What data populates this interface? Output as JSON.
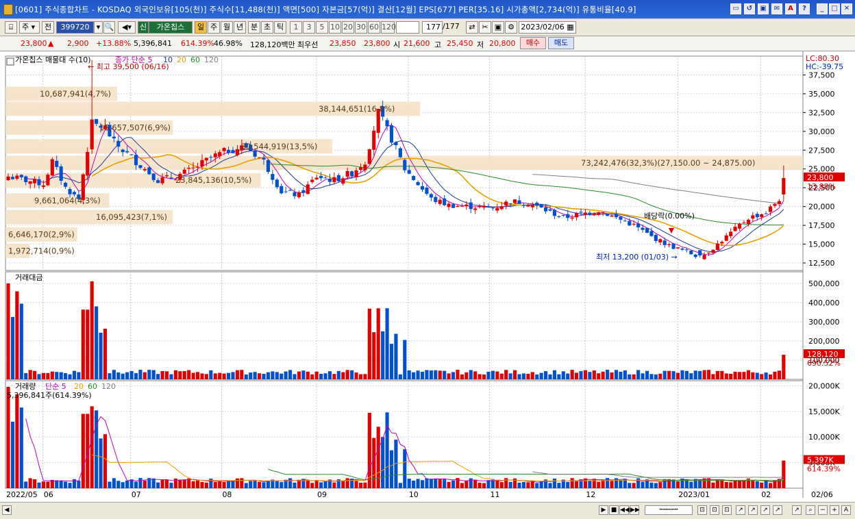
{
  "window": {
    "title": "[0601] 주식종합차트 - KOSDAQ 외국인보유[105(천)] 주식수[11,488(천)] 액면[500] 자본금[57(억)] 결산[12월] EPS[677] PER[35.16] 시가총액[2,734(억)] 유통비율[40.9]",
    "buttons": [
      "▭",
      "↺",
      "▣",
      "✉",
      "A",
      "?",
      "_",
      "□",
      "✕"
    ]
  },
  "toolbar": {
    "market": "주",
    "all": "전",
    "code": "399720",
    "stock_tag": "신",
    "stock_name": "가온칩스",
    "periods": [
      "일",
      "주",
      "월",
      "년",
      "분",
      "초",
      "틱"
    ],
    "ticks": [
      "1",
      "3",
      "5",
      "10",
      "20",
      "30",
      "60",
      "120"
    ],
    "count": "177",
    "count_total": "/177",
    "date": "2023/02/06"
  },
  "quote": {
    "price": "23,800",
    "arrow": "▲",
    "change": "2,900",
    "change_pct": "+13.88%",
    "volume": "5,396,841",
    "volume_ratio": "614.39%",
    "turnover": "46.98%",
    "amount": "128,120백만",
    "best_label": "최우선",
    "best_ask": "23,850",
    "best_bid": "23,800",
    "open_label": "시",
    "open": "21,600",
    "high_label": "고",
    "high": "25,450",
    "low_label": "저",
    "low": "20,800",
    "buy": "매수",
    "sell": "매도"
  },
  "price_panel": {
    "legend_name": "가온칩스 매물대 수(10)",
    "legend_ma": "종가 단순 5",
    "legend_ma_periods": [
      "10",
      "20",
      "60",
      "120"
    ],
    "lc": "LC:80.30",
    "hc": "HC:-39.75",
    "high_annot": "최고 39,500 (06/16)",
    "low_annot": "최저 13,200 (01/03)",
    "dividend": "배당락(0.00%)",
    "y_ticks": [
      "37,500",
      "35,000",
      "32,500",
      "30,000",
      "27,500",
      "25,000",
      "22,500",
      "20,000",
      "17,500",
      "15,000",
      "12,500"
    ],
    "last_price": "23,800",
    "last_pct": "13.88%",
    "volume_profile": [
      {
        "label": "10,687,941(4,7%)",
        "price": 35000
      },
      {
        "label": "15,657,507(6,9%)",
        "price": 30500
      },
      {
        "label": "38,144,651(16,8%)",
        "price": 33000
      },
      {
        "label": "30,544,919(13,5%)",
        "price": 28000
      },
      {
        "label": "73,242,476(32,3%)(27,150.00 ~ 24,875.00)",
        "price": 25800
      },
      {
        "label": "23,845,136(10,5%)",
        "price": 23500
      },
      {
        "label": "9,661,064(4,3%)",
        "price": 20800
      },
      {
        "label": "16,095,423(7,1%)",
        "price": 18600
      },
      {
        "label": "6,646,170(2,9%)",
        "price": 16300
      },
      {
        "label": "1,972,714(0,9%)",
        "price": 14100
      }
    ]
  },
  "amount_panel": {
    "legend": "거래대금",
    "y_ticks": [
      "500,000",
      "400,000",
      "300,000",
      "200,000",
      "100,000"
    ],
    "last_value": "128,120",
    "last_pct": "690.52%"
  },
  "volume_panel": {
    "legend_name": "거래량",
    "legend_ma": "단순 5",
    "legend_ma_periods": [
      "20",
      "60",
      "120"
    ],
    "last_info": "5,396,841주(614.39%)",
    "y_ticks": [
      "20,000K",
      "15,000K",
      "10,000K",
      "5,000K"
    ],
    "last_value": "5,397K",
    "last_pct": "614.39%"
  },
  "x_axis": {
    "labels": [
      "2022/05",
      "06",
      "07",
      "08",
      "09",
      "10",
      "11",
      "12",
      "2023/01",
      "02",
      "02/06"
    ]
  },
  "chart_data": {
    "type": "candlestick",
    "title": "",
    "ylim": [
      11500,
      40000
    ],
    "colors": {
      "up": "#e00000",
      "down": "#0050d0",
      "ma5": "#c000c0",
      "ma10": "#1a3a9a",
      "ma20": "#e8a000",
      "ma60": "#2a8a2a",
      "ma120": "#808080"
    },
    "close_series": [
      {
        "date": "2022/05",
        "close": 24000
      },
      {
        "date": "06/16",
        "close": 31000,
        "high": 39500
      },
      {
        "date": "07",
        "close": 24000
      },
      {
        "date": "08",
        "close": 26500
      },
      {
        "date": "09",
        "close": 24500
      },
      {
        "date": "09 end",
        "close": 32500
      },
      {
        "date": "10",
        "close": 21000
      },
      {
        "date": "11",
        "close": 20200
      },
      {
        "date": "12",
        "close": 18500
      },
      {
        "date": "2023/01/03",
        "close": 13200,
        "low": 13200
      },
      {
        "date": "2023/02/06",
        "close": 23800,
        "open": 21600,
        "high": 25450,
        "low": 20800
      }
    ]
  }
}
